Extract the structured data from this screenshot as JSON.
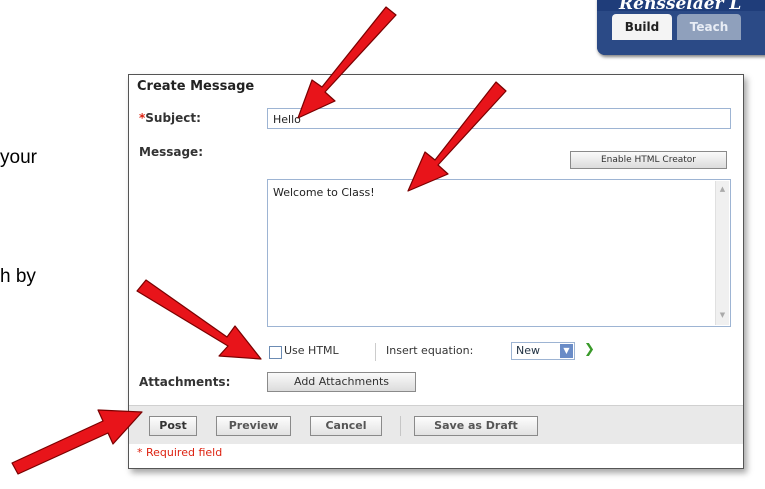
{
  "slide": {
    "side_text_1": "your",
    "side_text_2": "h by"
  },
  "header": {
    "site_title": "Rensselaer L",
    "tabs": [
      {
        "label": "Build",
        "active": true
      },
      {
        "label": "Teach",
        "active": false
      }
    ]
  },
  "dialog": {
    "title": "Create Message",
    "subject_required_mark": "*",
    "subject_label": "Subject:",
    "subject_value": "Hello",
    "message_label": "Message:",
    "enable_html_button": "Enable HTML Creator",
    "message_body": "Welcome to Class!",
    "use_html_label": "Use HTML",
    "use_html_checked": false,
    "insert_equation_label": "Insert equation:",
    "equation_select_value": "New",
    "attachments_label": "Attachments:",
    "add_attachments_button": "Add Attachments",
    "footer_buttons": {
      "post": "Post",
      "preview": "Preview",
      "cancel": "Cancel",
      "save_draft": "Save as Draft"
    },
    "required_note": "* Required field"
  },
  "colors": {
    "arrow": "#e8141a",
    "header_bg": "#1f3d7a",
    "required": "#d21111",
    "input_border": "#9db4d3"
  },
  "annotations": {
    "arrow_count": 4,
    "arrow_targets": [
      "subject-input",
      "message-textarea",
      "add-attachments-button",
      "post-button"
    ]
  }
}
